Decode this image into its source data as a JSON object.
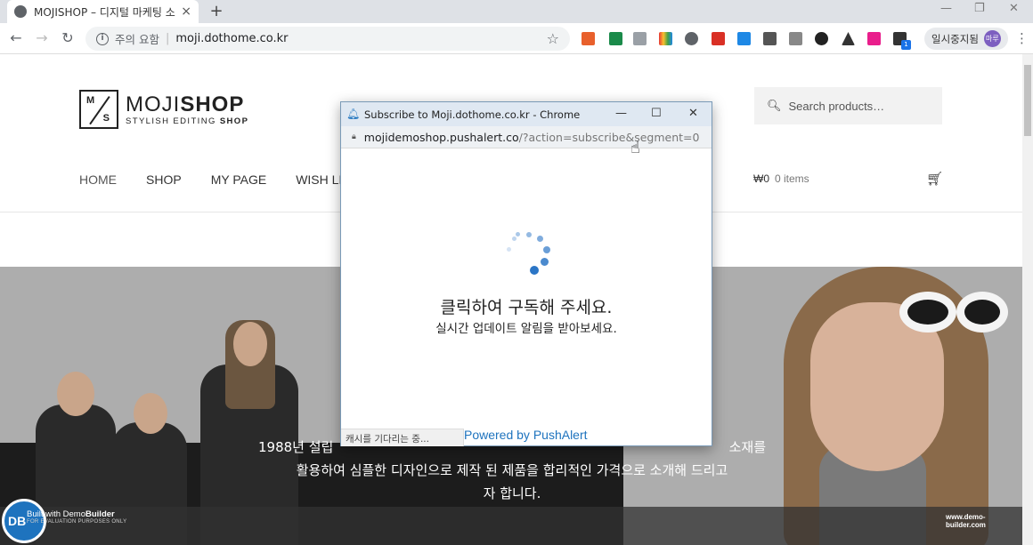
{
  "browser": {
    "tab_title": "MOJISHOP – 디지털 마케팅 소호",
    "tab_close": "×",
    "new_tab": "+",
    "security_text": "주의 요함",
    "url": "moji.dothome.co.kr",
    "profile_label": "일시중지됨",
    "profile_avatar": "마루",
    "extension_badge": "1",
    "window_controls": [
      "—",
      "❐",
      "✕"
    ]
  },
  "site": {
    "logo_brand_light": "MOJI",
    "logo_brand_bold": "SHOP",
    "logo_tagline_light": "STYLISH EDITING ",
    "logo_tagline_bold": "SHOP",
    "logo_mark_m": "M",
    "logo_mark_s": "S",
    "search_placeholder": "Search products…",
    "nav": [
      "HOME",
      "SHOP",
      "MY PAGE",
      "WISH LIST"
    ],
    "cart_amount": "₩0",
    "cart_count": "0 items",
    "hero_text": "1988년 설립 한 ㅇㅇ한 ㅇㅇ는 ㅇㅇ가 ㅇㅇ의 ㅇㅇ 소재를 활용하여 심플한 디자인으로 제작 된 제품을 합리적인 가격으로 소개해 드리고 자 합니다.",
    "hero_line1_visible": "1988년 설립",
    "hero_line1_end": "소재를",
    "hero_line2": "활용하여 심플한 디자인으로 제작 된 제품을 합리적인 가격으로 소개해 드리고",
    "hero_line3": "자 합니다."
  },
  "demobuilder": {
    "logo": "DB",
    "built_with": "Built with Demo",
    "builder": "Builder",
    "eval": "FOR EVALUATION PURPOSES ONLY",
    "url": "www.demo-builder.com"
  },
  "popup": {
    "title": "Subscribe to Moji.dothome.co.kr - Chrome",
    "host": "mojidemoshop.pushalert.co",
    "path": "/?action=subscribe&segment=0",
    "heading": "클릭하여 구독해 주세요.",
    "subheading": "실시간 업데이트 알림을 받아보세요.",
    "status": "캐시를 기다리는 중...",
    "powered": "Powered by PushAlert"
  },
  "colors": {
    "accent": "#1e73be",
    "popup_title_bg": "#dfe8f2",
    "hero_bg": "#adadad"
  }
}
